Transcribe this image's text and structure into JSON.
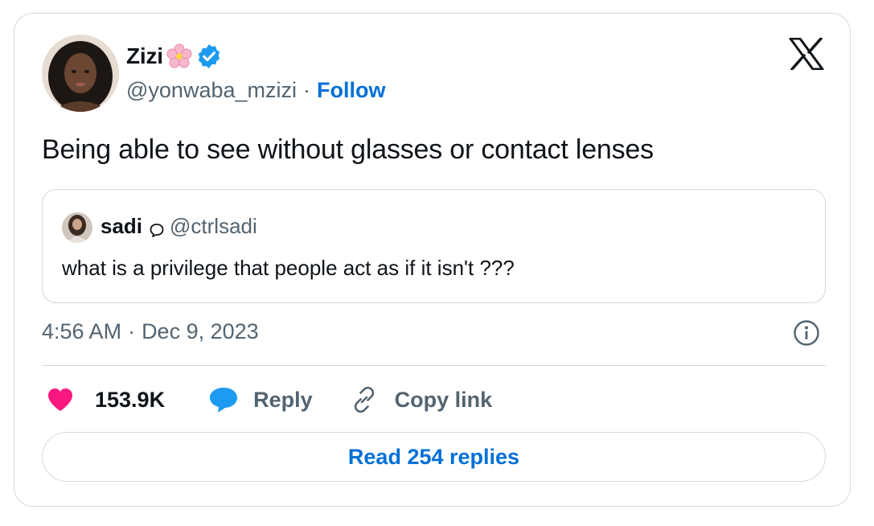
{
  "colors": {
    "accent_blue": "#006fd6",
    "muted_text": "#536471",
    "border": "#cfd9de",
    "like_pink": "#f91880",
    "reply_blue": "#1d9bf0",
    "verified_blue": "#1d9bf0"
  },
  "author": {
    "name": "Zizi",
    "name_emoji_icon": "cherry-blossom-icon",
    "verified_icon": "verified-badge-icon",
    "handle": "@yonwaba_mzizi",
    "separator": "·",
    "follow_label": "Follow"
  },
  "platform_icon": "x-logo-icon",
  "tweet": {
    "text": "Being able to see without glasses or contact lenses"
  },
  "quoted_tweet": {
    "name": "sadi",
    "badge_icon": "speech-bubble-outline-icon",
    "handle": "@ctrlsadi",
    "text": "what is a privilege that people act as if it isn't ???"
  },
  "meta": {
    "time": "4:56 AM",
    "separator": "·",
    "date": "Dec 9, 2023",
    "info_icon": "info-icon"
  },
  "actions": {
    "likes": "153.9K",
    "reply_label": "Reply",
    "copy_link_label": "Copy link"
  },
  "read_replies_label": "Read 254 replies"
}
